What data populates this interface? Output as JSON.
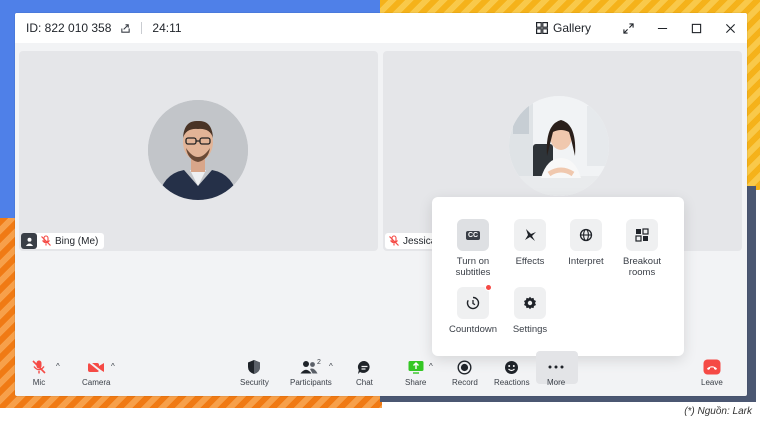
{
  "header": {
    "meeting_id": "ID: 822 010 358",
    "timer": "24:11",
    "view_label": "Gallery"
  },
  "participants": [
    {
      "name": "Bing (Me)",
      "mic": "muted"
    },
    {
      "name": "Jessica",
      "mic": "muted"
    }
  ],
  "more_menu": {
    "items": [
      {
        "label": "Turn on subtitles",
        "icon": "cc-icon"
      },
      {
        "label": "Effects",
        "icon": "sparkle-icon"
      },
      {
        "label": "Interpret",
        "icon": "globe-icon"
      },
      {
        "label": "Breakout rooms",
        "icon": "grid-icon"
      },
      {
        "label": "Countdown",
        "icon": "timer-icon"
      },
      {
        "label": "Settings",
        "icon": "gear-icon"
      }
    ],
    "cc_glyph": "CC"
  },
  "toolbar": {
    "mic": "Mic",
    "camera": "Camera",
    "security": "Security",
    "participants": "Participants",
    "participants_count": "2",
    "chat": "Chat",
    "share": "Share",
    "record": "Record",
    "reactions": "Reactions",
    "more": "More",
    "leave": "Leave"
  },
  "caption": "(*) Nguồn: Lark",
  "colors": {
    "danger": "#f54a45",
    "share_green": "#34c724",
    "blue": "#4f80e8",
    "yellow": "#f5b21a",
    "orange": "#f07a14",
    "navy": "#4b5772"
  }
}
